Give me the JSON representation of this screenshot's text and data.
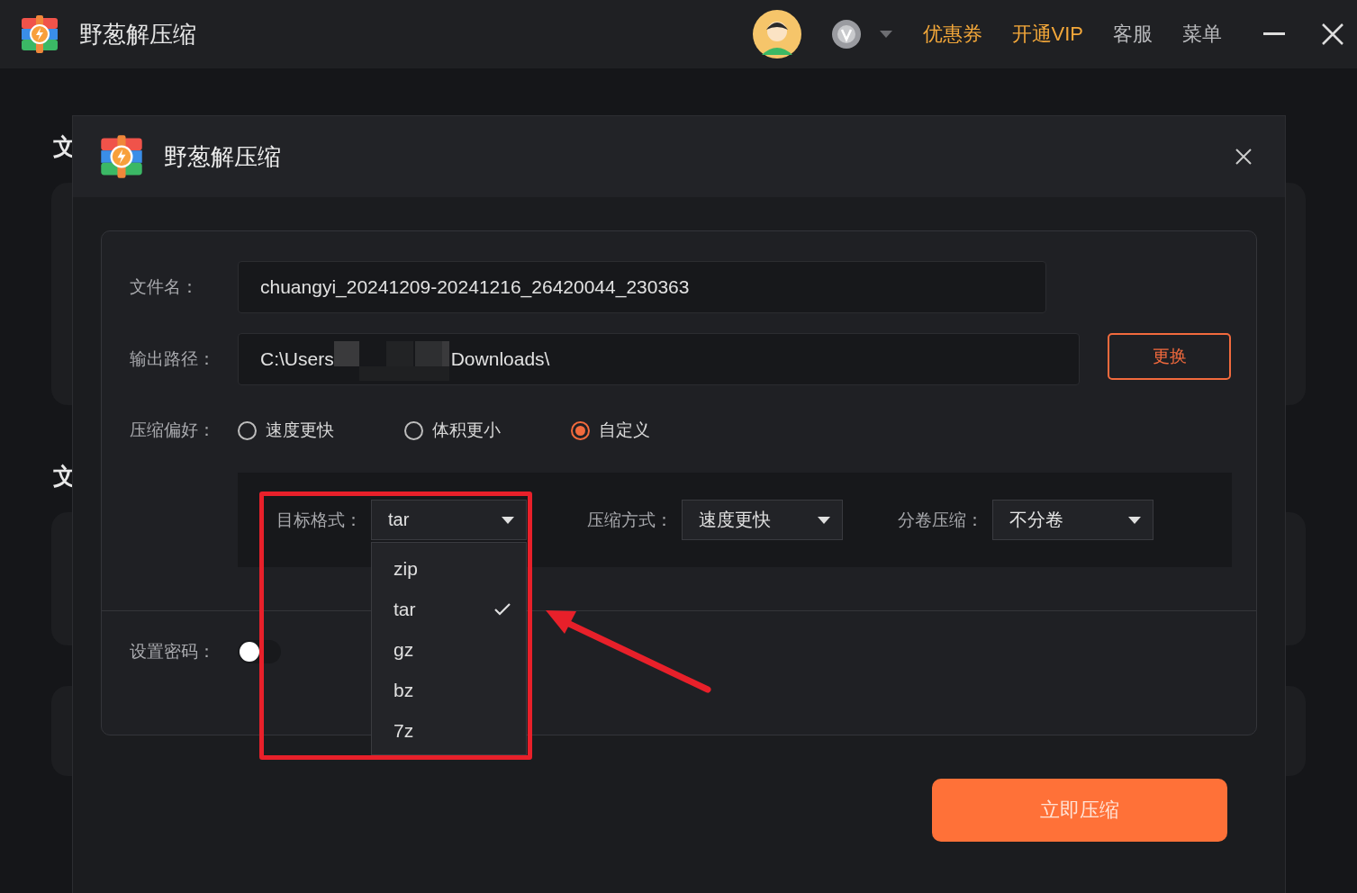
{
  "app": {
    "title": "野葱解压缩"
  },
  "top_menu": [
    {
      "label": "优惠券",
      "kind": "promo"
    },
    {
      "label": "开通VIP",
      "kind": "promo"
    },
    {
      "label": "客服",
      "kind": "plain"
    },
    {
      "label": "菜单",
      "kind": "plain"
    }
  ],
  "background_labels": [
    "文",
    "文"
  ],
  "dialog": {
    "title": "野葱解压缩",
    "file_name": {
      "label": "文件名：",
      "value": "chuangyi_20241209-20241216_26420044_230363"
    },
    "output_path": {
      "label": "输出路径：",
      "value_start": "C:\\Users",
      "value_end": "Downloads\\",
      "button": "更换"
    },
    "preference": {
      "label": "压缩偏好：",
      "options": [
        {
          "label": "速度更快",
          "selected": false
        },
        {
          "label": "体积更小",
          "selected": false
        },
        {
          "label": "自定义",
          "selected": true
        }
      ]
    },
    "custom_selects": [
      {
        "label": "目标格式：",
        "value": "tar",
        "options": [
          {
            "label": "zip",
            "checked": false
          },
          {
            "label": "tar",
            "checked": true
          },
          {
            "label": "gz",
            "checked": false
          },
          {
            "label": "bz",
            "checked": false
          },
          {
            "label": "7z",
            "checked": false
          }
        ]
      },
      {
        "label": "压缩方式：",
        "value": "速度更快"
      },
      {
        "label": "分卷压缩：",
        "value": "不分卷"
      }
    ],
    "password": {
      "label": "设置密码：",
      "on": false
    },
    "start_button": "立即压缩"
  }
}
